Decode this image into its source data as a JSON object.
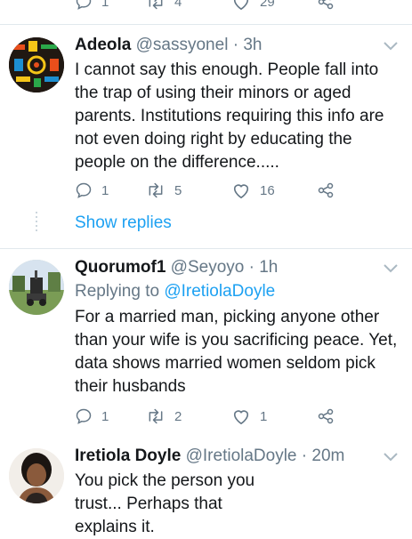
{
  "top_actions": {
    "reply_count": "1",
    "retweet_count": "4",
    "like_count": "29"
  },
  "tweets": [
    {
      "name": "Adeola",
      "handle": "@sassyonel",
      "time": "3h",
      "reply_to": "",
      "text": "I cannot say this enough. People fall into the trap of using their minors or aged parents. Institutions requiring this info are not even doing right by educating the people on the difference.....",
      "reply_count": "1",
      "retweet_count": "5",
      "like_count": "16"
    },
    {
      "name": "Quorumof1",
      "handle": "@Seyoyo",
      "time": "1h",
      "reply_to_prefix": "Replying to ",
      "reply_to": "@IretiolaDoyle",
      "text": "For a married man, picking anyone other than your wife is you sacrificing peace. Yet, data shows married women seldom pick their husbands",
      "reply_count": "1",
      "retweet_count": "2",
      "like_count": "1"
    },
    {
      "name": "Iretiola Doyle",
      "handle": "@IretiolaDoyle",
      "time": "20m",
      "reply_to": "",
      "text": "You pick the person you trust... Perhaps that explains it."
    }
  ],
  "show_replies_label": "Show replies",
  "colors": {
    "accent": "#1da1f2",
    "muted": "#657786",
    "divider": "#e1e8ed"
  }
}
